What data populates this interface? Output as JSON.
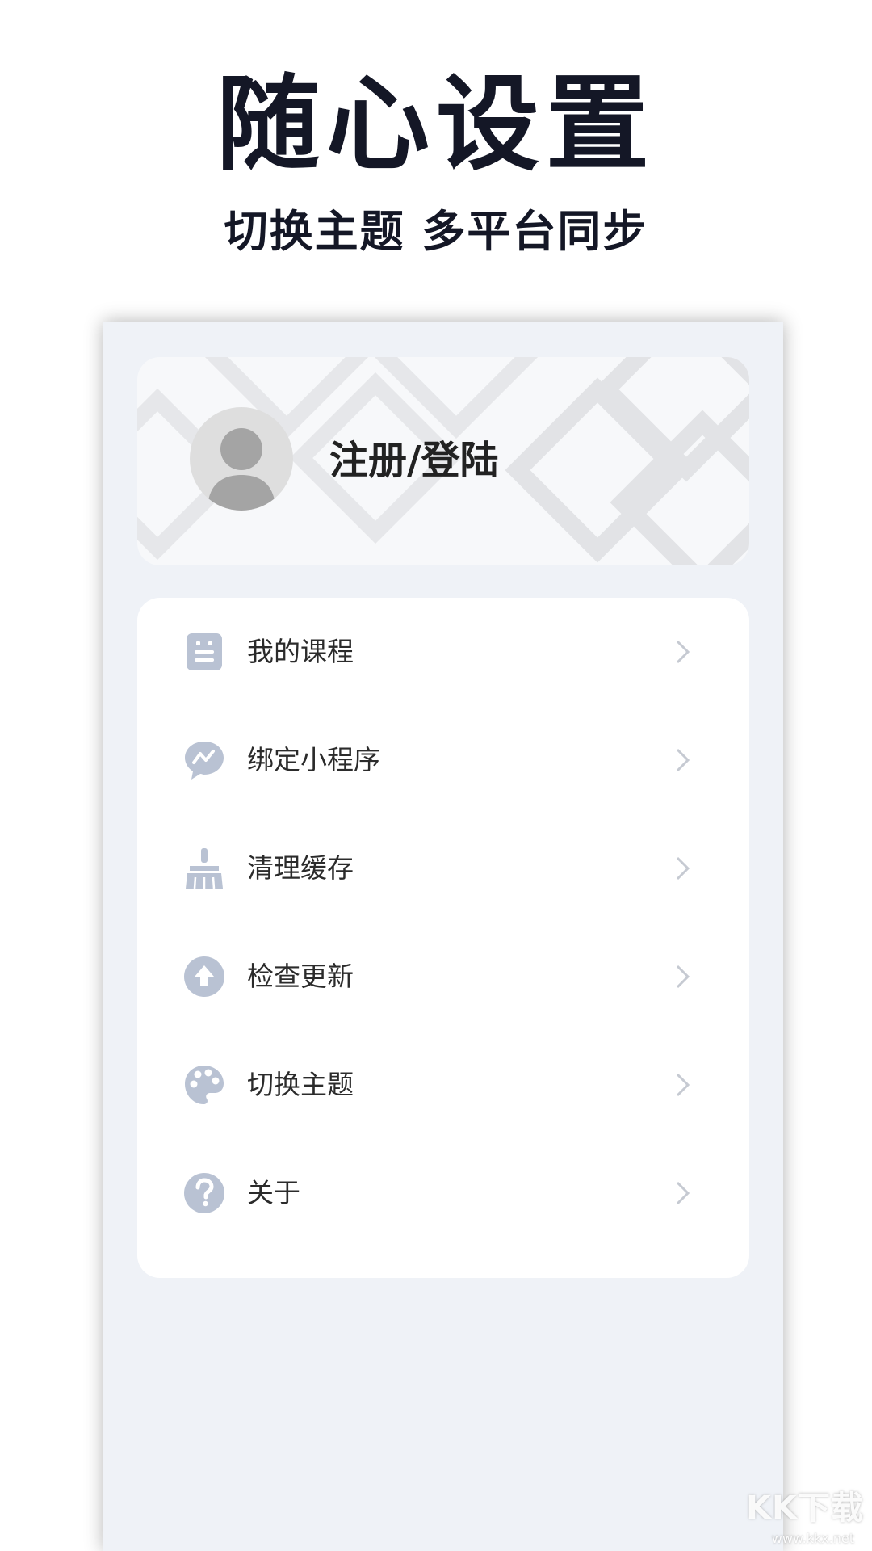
{
  "promo": {
    "title": "随心设置",
    "subtitle": "切换主题 多平台同步"
  },
  "profile": {
    "login_label": "注册/登陆",
    "avatar_icon": "user-avatar-icon"
  },
  "menu": {
    "items": [
      {
        "label": "我的课程",
        "icon": "course-icon"
      },
      {
        "label": "绑定小程序",
        "icon": "chat-bubble-icon"
      },
      {
        "label": "清理缓存",
        "icon": "broom-icon"
      },
      {
        "label": "检查更新",
        "icon": "upload-arrow-icon"
      },
      {
        "label": "切换主题",
        "icon": "palette-icon"
      },
      {
        "label": "关于",
        "icon": "question-icon"
      }
    ],
    "chevron_icon": "chevron-right-icon"
  },
  "colors": {
    "icon": "#b9c2d3",
    "screen_bg": "#eff2f7",
    "title": "#141726"
  },
  "watermark": {
    "brand": "KK下载",
    "url": "www.kkx.net"
  }
}
